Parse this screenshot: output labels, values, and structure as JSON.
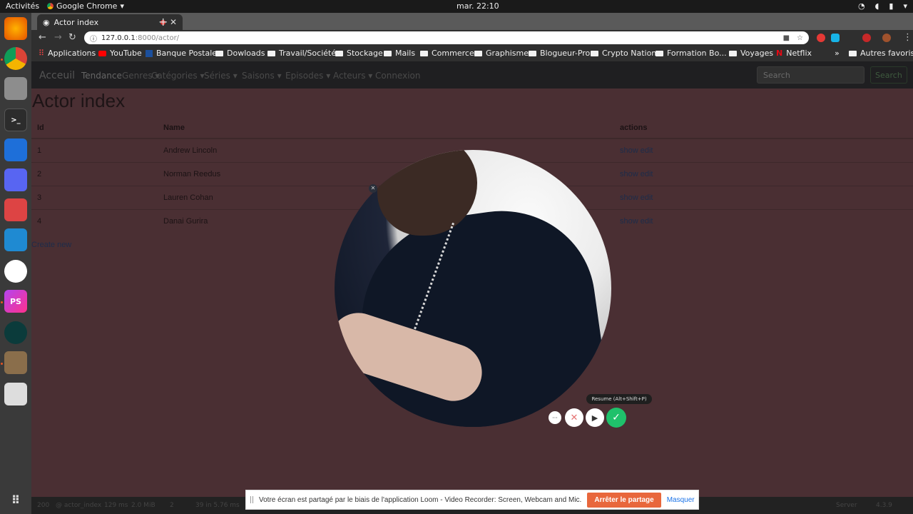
{
  "system": {
    "activities": "Activités",
    "app_name": "Google Chrome",
    "clock": "mar. 22:10"
  },
  "browser": {
    "tab_title": "Actor index",
    "url_host": "127.0.0.1",
    "url_path": ":8000/actor/",
    "bookmarks": [
      "Applications",
      "YouTube",
      "Banque Postale",
      "Dowloads",
      "Travail/Société",
      "Stockage",
      "Mails",
      "Commerce",
      "Graphisme",
      "Blogueur-Pro",
      "Crypto Nation",
      "Formation Bo...",
      "Voyages",
      "Netflix"
    ],
    "bookmarks_more": "»",
    "other_bookmarks": "Autres favoris"
  },
  "site_nav": {
    "brand": "Acceuil",
    "links": [
      "Tendance",
      "Genres ▾",
      "Catégories ▾",
      "Séries ▾",
      "Saisons ▾",
      "Episodes ▾",
      "Acteurs ▾",
      "Connexion"
    ],
    "search_placeholder": "Search",
    "search_button": "Search"
  },
  "main": {
    "title": "Actor index",
    "columns": [
      "Id",
      "Name",
      "actions"
    ],
    "rows": [
      {
        "id": "1",
        "name": "Andrew Lincoln",
        "actions": "show edit"
      },
      {
        "id": "2",
        "name": "Norman Reedus",
        "actions": "show edit"
      },
      {
        "id": "3",
        "name": "Lauren Cohan",
        "actions": "show edit"
      },
      {
        "id": "4",
        "name": "Danai Gurira",
        "actions": "show edit"
      }
    ],
    "create_link": "Create new"
  },
  "debug_toolbar": {
    "status": "200",
    "route": "@ actor_index",
    "time": "129 ms",
    "memory": "2.0 MiB",
    "logs": "2",
    "queries": "39 in 5.76 ms",
    "server": "Server",
    "version": "4.3.9"
  },
  "loom": {
    "tooltip": "Resume (Alt+Shift+P)",
    "share_message": "Votre écran est partagé par le biais de l'application Loom - Video Recorder: Screen, Webcam and Mic.",
    "stop_share": "Arrêter le partage",
    "hide": "Masquer"
  },
  "colors": {
    "page_bg": "#4a2f33",
    "stop_button": "#e8673c",
    "confirm_button": "#1fc16b",
    "record_dot": "#e53935"
  }
}
